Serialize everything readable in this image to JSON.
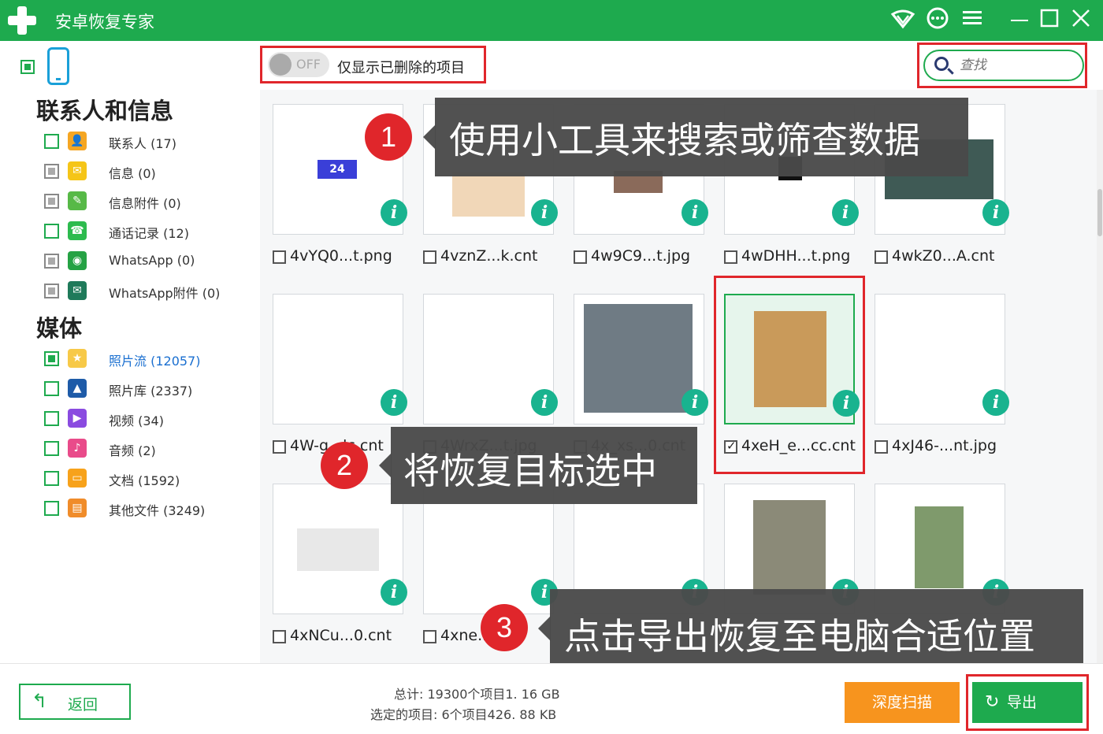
{
  "app": {
    "title": "安卓恢复专家"
  },
  "titlebar_icons": [
    "wifi-icon",
    "chat-icon",
    "menu-icon",
    "minimize-icon",
    "maximize-icon",
    "close-icon"
  ],
  "sidebar": {
    "section_contacts": "联系人和信息",
    "section_media": "媒体",
    "items": [
      {
        "label": "联系人 (17)",
        "icon": "contact-icon",
        "color": "#f5a623",
        "state": "unchecked"
      },
      {
        "label": "信息 (0)",
        "icon": "message-icon",
        "color": "#f5c518",
        "state": "partial"
      },
      {
        "label": "信息附件 (0)",
        "icon": "attachment-icon",
        "color": "#57b947",
        "state": "partial"
      },
      {
        "label": "通话记录 (12)",
        "icon": "phone-call-icon",
        "color": "#2dbb4e",
        "state": "unchecked"
      },
      {
        "label": "WhatsApp (0)",
        "icon": "whatsapp-icon",
        "color": "#25a244",
        "state": "partial"
      },
      {
        "label": "WhatsApp附件 (0)",
        "icon": "whatsapp-attachment-icon",
        "color": "#1f7a5a",
        "state": "partial"
      },
      {
        "label": "照片流 (12057)",
        "icon": "photo-stream-icon",
        "color": "#f7c948",
        "state": "checked"
      },
      {
        "label": "照片库 (2337)",
        "icon": "photo-library-icon",
        "color": "#1e5ba8",
        "state": "unchecked"
      },
      {
        "label": "视频 (34)",
        "icon": "video-icon",
        "color": "#8a4be0",
        "state": "unchecked"
      },
      {
        "label": "音频 (2)",
        "icon": "audio-icon",
        "color": "#e94b8a",
        "state": "unchecked"
      },
      {
        "label": "文档 (1592)",
        "icon": "document-icon",
        "color": "#f7a21b",
        "state": "unchecked"
      },
      {
        "label": "其他文件 (3249)",
        "icon": "other-files-icon",
        "color": "#f08c2a",
        "state": "unchecked"
      }
    ]
  },
  "toolbar": {
    "toggle_state": "OFF",
    "filter_label": "仅显示已删除的项目",
    "search_placeholder": "查找"
  },
  "files": [
    {
      "name": "4vYQ0...t.png",
      "checked": false,
      "badge_text": "24"
    },
    {
      "name": "4vznZ...k.cnt",
      "checked": false
    },
    {
      "name": "4w9C9...t.jpg",
      "checked": false
    },
    {
      "name": "4wDHH...t.png",
      "checked": false
    },
    {
      "name": "4wkZ0...A.cnt",
      "checked": false
    },
    {
      "name": "4W-g...lc.cnt",
      "checked": false
    },
    {
      "name": "4WrxZ...t.jpg",
      "checked": false
    },
    {
      "name": "4x_xs...0.cnt",
      "checked": false
    },
    {
      "name": "4xeH_e...cc.cnt",
      "checked": true
    },
    {
      "name": "4xJ46-...nt.jpg",
      "checked": false
    },
    {
      "name": "4xNCu...0.cnt",
      "checked": false
    },
    {
      "name": "4xne...g",
      "checked": false
    },
    {
      "name": "",
      "checked": false
    },
    {
      "name": "",
      "checked": false
    },
    {
      "name": "",
      "checked": false
    }
  ],
  "callouts": [
    {
      "number": "1",
      "text": "使用小工具来搜索或筛查数据"
    },
    {
      "number": "2",
      "text": "将恢复目标选中"
    },
    {
      "number": "3",
      "text": "点击导出恢复至电脑合适位置"
    }
  ],
  "bottom": {
    "back_label": "返回",
    "total_line": "总计: 19300个项目1. 16 GB",
    "selected_line": "选定的项目: 6个项目426. 88 KB",
    "deep_scan_label": "深度扫描",
    "export_label": "导出"
  },
  "colors": {
    "brand_green": "#1eaa4e",
    "highlight_red": "#e0262b",
    "info_teal": "#19b38f",
    "deep_scan_orange": "#f7941e"
  }
}
